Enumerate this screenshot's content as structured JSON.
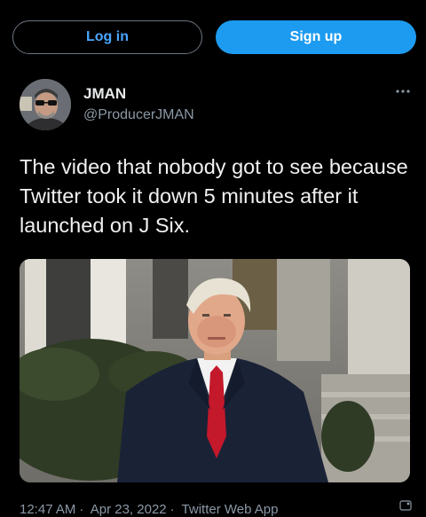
{
  "auth": {
    "login_label": "Log in",
    "signup_label": "Sign up"
  },
  "author": {
    "name": "JMAN",
    "handle": "@ProducerJMAN"
  },
  "tweet": {
    "text": "The video that nobody got to see because Twitter took it down 5 minutes after it launched on J Six.",
    "time": "12:47 AM",
    "date": "Apr 23, 2022",
    "source": "Twitter Web App",
    "separator": "·"
  },
  "icons": {
    "more": "more-icon",
    "avatar": "avatar-photo",
    "media": "video-thumbnail"
  },
  "colors": {
    "accent": "#1d9bf0",
    "background": "#000000",
    "muted": "#8b98a5"
  }
}
